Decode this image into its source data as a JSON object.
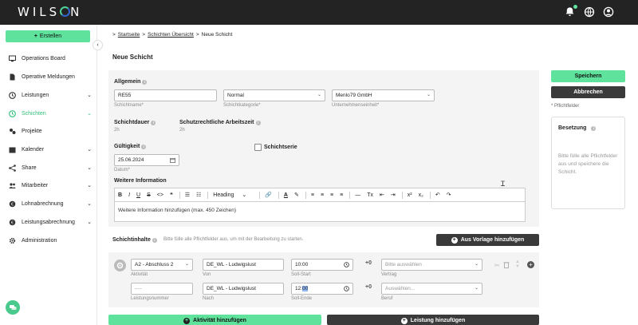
{
  "header": {
    "logo": "WILSON"
  },
  "sidebar": {
    "create_label": "Erstellen",
    "items": [
      {
        "label": "Operations Board",
        "icon": "monitor-icon",
        "chevron": ""
      },
      {
        "label": "Operative Meldungen",
        "icon": "document-icon",
        "chevron": ""
      },
      {
        "label": "Leistungen",
        "icon": "clock-icon",
        "chevron": "⌄"
      },
      {
        "label": "Schichten",
        "icon": "shifts-icon",
        "chevron": "⌄"
      },
      {
        "label": "Projekte",
        "icon": "projects-icon",
        "chevron": ""
      },
      {
        "label": "Kalender",
        "icon": "calendar-icon",
        "chevron": "⌄"
      },
      {
        "label": "Share",
        "icon": "share-icon",
        "chevron": "⌄"
      },
      {
        "label": "Mitarbeiter",
        "icon": "people-icon",
        "chevron": "⌄"
      },
      {
        "label": "Lohnabrechnung",
        "icon": "payroll-icon",
        "chevron": "⌄"
      },
      {
        "label": "Leistungsabrechnung",
        "icon": "billing-icon",
        "chevron": "⌄"
      },
      {
        "label": "Administration",
        "icon": "gear-icon",
        "chevron": ""
      }
    ],
    "active_index": 3,
    "collapse_glyph": "‹"
  },
  "breadcrumb": {
    "items": [
      "Startseite",
      "Schichten Übersicht",
      "Neue Schicht"
    ],
    "separator": ">"
  },
  "page": {
    "title": "Neue Schicht"
  },
  "allgemein": {
    "title": "Allgemein",
    "name_value": "RE55",
    "name_label": "Schichtname*",
    "category_value": "Normal",
    "category_label": "Schichtkategorie*",
    "unit_value": "Menlo79 GmbH",
    "unit_label": "Unternehmenseinheit*"
  },
  "duration": {
    "title": "Schichtdauer",
    "value": "2h",
    "protection_title": "Schutzrechtliche Arbeitszeit",
    "protection_value": "2h"
  },
  "validity": {
    "title": "Gültigkeit",
    "date_value": "25.06.2024",
    "date_label": "Datum*",
    "series_label": "Schichtserie"
  },
  "info": {
    "title": "Weitere Information",
    "toolbar": [
      "B",
      "I",
      "U",
      "S",
      "<>",
      "❝",
      "☰",
      "☷",
      "Heading",
      "⌄",
      "🔗",
      "A",
      "✎",
      "≡",
      "≡",
      "≡",
      "≡",
      "—",
      "Tx",
      "⇤",
      "⇥",
      "x²",
      "x₂",
      "↶",
      "↷"
    ],
    "placeholder": "Weitere Information hinzufügen (max. 450 Zeichen)"
  },
  "contents": {
    "title": "Schichtinhalte",
    "hint": "Bitte fülle alle Pflichtfelder aus, um mit der Bearbeitung zu starten.",
    "template_button": "Aus Vorlage hinzufügen",
    "row1": {
      "activity_value": "A2 - Abschluss 2",
      "activity_label": "Aktivität",
      "from_value": "DE_WL - Ludwigslust",
      "from_label": "Von",
      "start_value": "10:00",
      "start_label": "Soll-Start",
      "plus": "+0",
      "contract_placeholder": "Bitte auswählen",
      "contract_label": "Vertrag"
    },
    "row2": {
      "service_value": "----",
      "service_label": "Leistungsnummer",
      "to_value": "DE_WL - Ludwigslust",
      "to_label": "Nach",
      "end_value_a": "12:",
      "end_value_b": "00",
      "end_label": "Soll-Ende",
      "plus": "+0",
      "job_placeholder": "Auswählen...",
      "job_label": "Beruf"
    }
  },
  "actions": {
    "add_activity": "Aktivität hinzufügen",
    "add_service": "Leistung hinzufügen",
    "save": "Speichern",
    "cancel": "Abbrechen",
    "required_note": "* Pflichtfelder"
  },
  "occupancy": {
    "title": "Besetzung",
    "message": "Bitte fülle alle Pflichtfelder aus und speichere die Schicht."
  },
  "colors": {
    "accent": "#5ee29c",
    "dark": "#232323",
    "active": "#2fbf78"
  }
}
